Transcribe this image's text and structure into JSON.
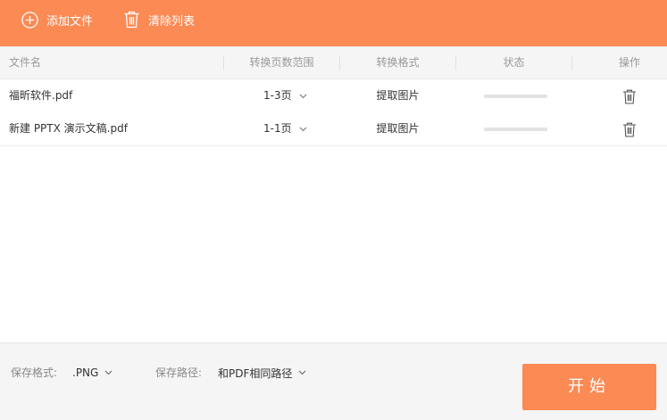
{
  "toolbar": {
    "add_files_label": "添加文件",
    "clear_list_label": "清除列表"
  },
  "table": {
    "columns": [
      "文件名",
      "转换页数范围",
      "转换格式",
      "状态",
      "操作"
    ],
    "rows": [
      {
        "filename": "福昕软件.pdf",
        "page_range": "1-3页",
        "format": "提取图片",
        "progress": 0
      },
      {
        "filename": "新建 PPTX 演示文稿.pdf",
        "page_range": "1-1页",
        "format": "提取图片",
        "progress": 0
      }
    ]
  },
  "footer": {
    "save_format_label": "保存格式:",
    "save_format_value": ".PNG",
    "save_path_label": "保存路径:",
    "save_path_value": "和PDF相同路径",
    "start_label": "开始"
  },
  "icons": {
    "add": "plus-circle-icon",
    "clear": "trash-icon",
    "dropdown": "chevron-down-icon",
    "delete": "trash-icon"
  },
  "colors": {
    "accent": "#fb8a54",
    "header_bg": "#f5f5f5",
    "progress_track": "#e2e2e2"
  }
}
